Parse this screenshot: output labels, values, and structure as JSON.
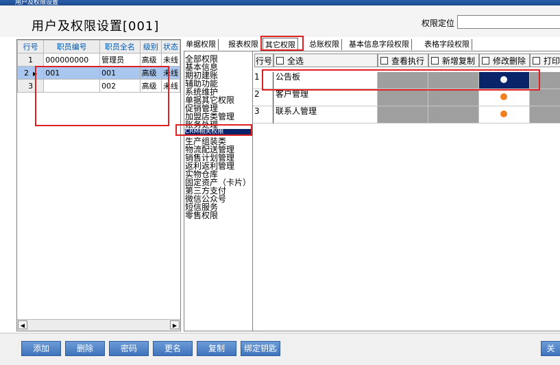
{
  "window": {
    "title": "用户及权限设置"
  },
  "header": {
    "title": "用户及权限设置[001]",
    "locate_label": "权限定位",
    "locate_value": ""
  },
  "staff_grid": {
    "columns": [
      "行号",
      "职员编号",
      "职员全名",
      "级别",
      "状态"
    ],
    "rows": [
      {
        "no": "1",
        "code": "000000000",
        "name": "管理员",
        "level": "高级",
        "status": "未线"
      },
      {
        "no": "2",
        "code": "001",
        "name": "001",
        "level": "高级",
        "status": "未线"
      },
      {
        "no": "3",
        "code": "",
        "name": "002",
        "level": "高级",
        "status": "未线"
      }
    ]
  },
  "tabs": [
    "单据权限",
    "报表权限",
    "其它权限",
    "总账权限",
    "基本信息字段权限",
    "表格字段权限"
  ],
  "tree": [
    "全部权限",
    "基本信息",
    "期初建账",
    "辅助功能",
    "系统维护",
    "单据其它权限",
    "促销管理",
    "加盟店类管理",
    "账务处理",
    "CRM相关权限",
    "生产组装类",
    "物流配送管理",
    "销售计划管理",
    "返利返利管理",
    "实物仓库",
    "固定资产（卡片）",
    "第三方支付",
    "微信公众号",
    "短信服务",
    "零售权限"
  ],
  "perm_grid": {
    "headers": {
      "rowno": "行号",
      "all": "全选",
      "view": "查看执行",
      "add": "新增复制",
      "edit": "修改删除",
      "print": "打印"
    },
    "rows": [
      {
        "no": "1",
        "name": "公告板",
        "edit": true
      },
      {
        "no": "2",
        "name": "客户管理",
        "edit": true
      },
      {
        "no": "3",
        "name": "联系人管理",
        "edit": true
      }
    ],
    "colors": {
      "dot_selected": "#ffffff",
      "dot_normal": "#f08020",
      "highlight": "#0a246a",
      "locked": "#9f9f9f"
    }
  },
  "buttons": {
    "add": "添加",
    "delete": "删除",
    "password": "密码",
    "rename": "更名",
    "copy": "复制",
    "bind_key": "绑定钥匙",
    "close": "关"
  }
}
